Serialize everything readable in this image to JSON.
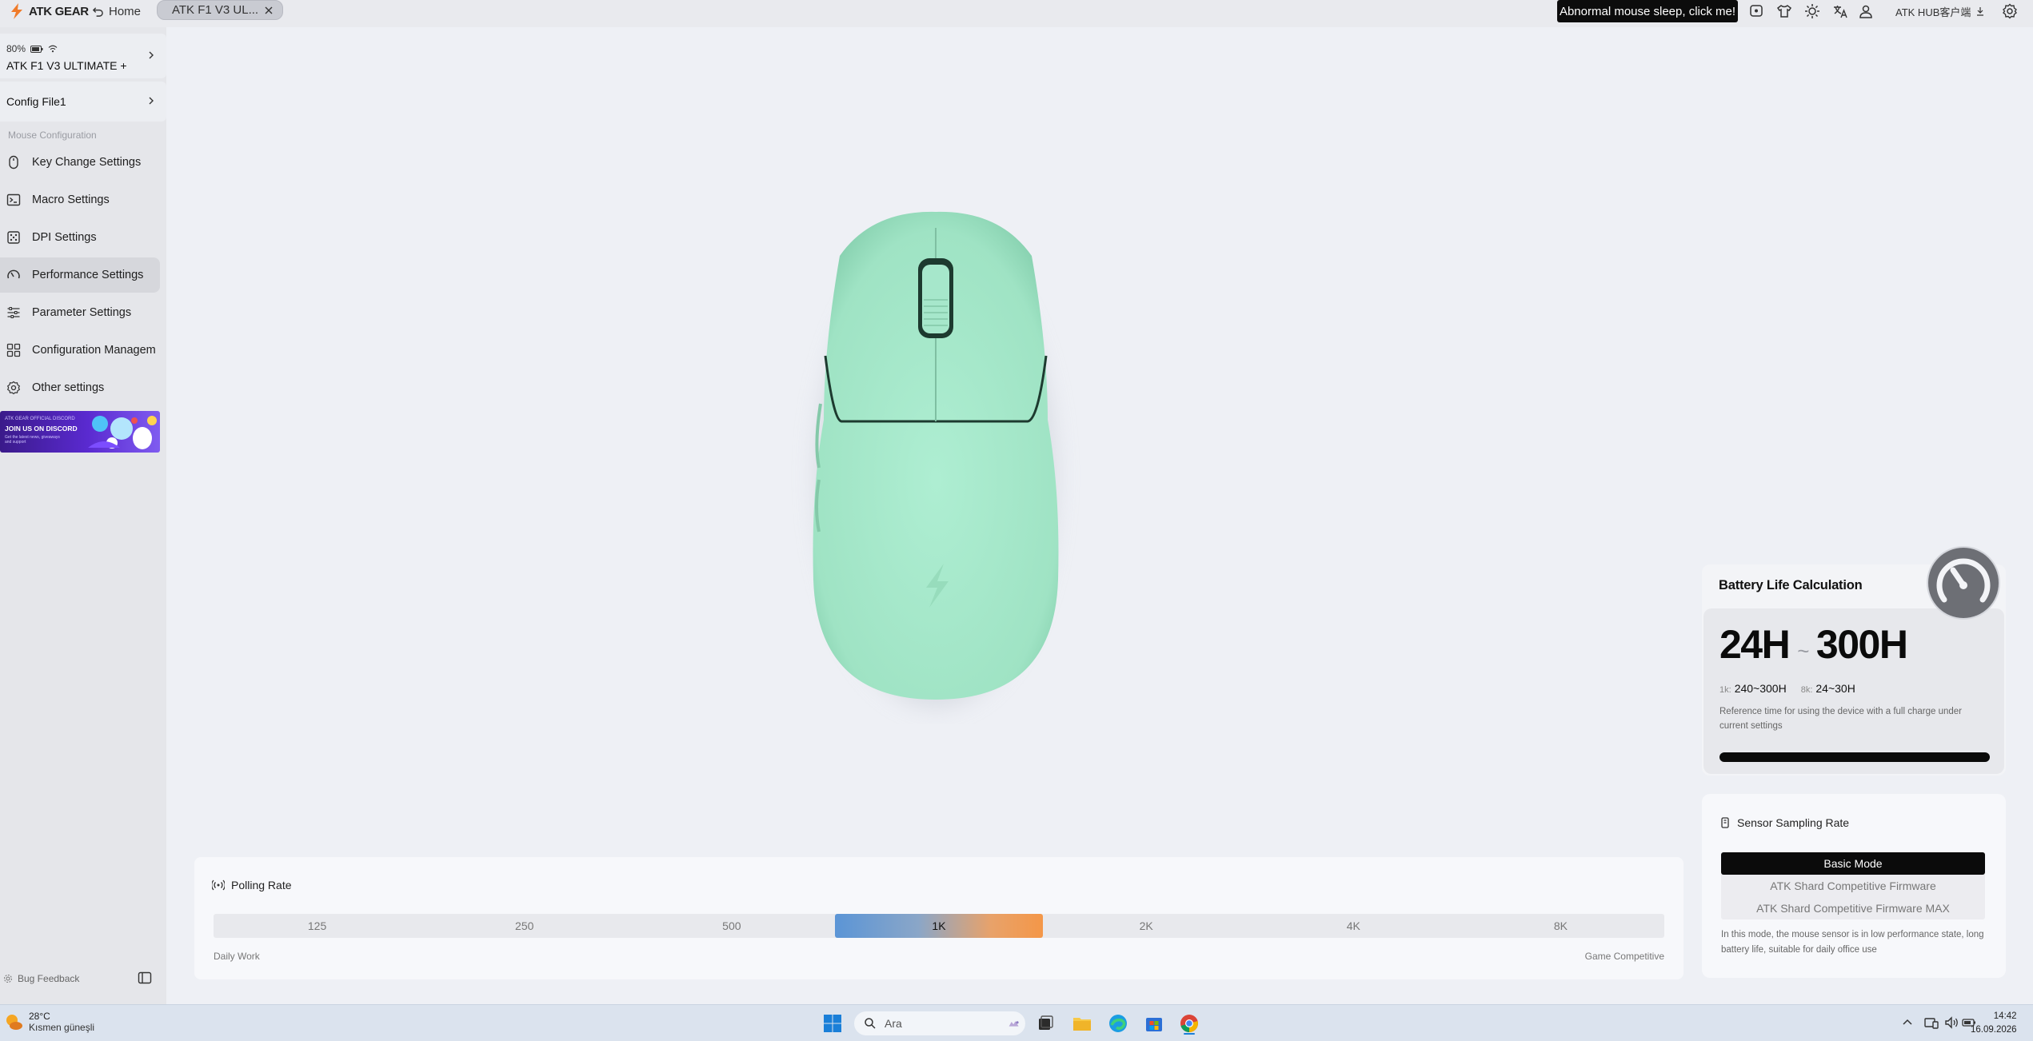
{
  "topbar": {
    "brand": "ATK GEAR",
    "home_label": "Home",
    "tab_label": "ATK F1 V3 UL...",
    "notice": "Abnormal mouse sleep, click me!",
    "hub_label": "ATK HUB客户端"
  },
  "device": {
    "battery": "80%",
    "name": "ATK F1 V3 ULTIMATE +",
    "config": "Config File1"
  },
  "sidebar": {
    "section_title": "Mouse Configuration",
    "items": [
      {
        "label": "Key Change Settings",
        "icon": "mouse-icon"
      },
      {
        "label": "Macro Settings",
        "icon": "terminal-icon"
      },
      {
        "label": "DPI Settings",
        "icon": "dice-icon"
      },
      {
        "label": "Performance Settings",
        "icon": "gauge-icon",
        "active": true
      },
      {
        "label": "Parameter Settings",
        "icon": "sliders-icon"
      },
      {
        "label": "Configuration Managem",
        "icon": "grid-icon"
      },
      {
        "label": "Other settings",
        "icon": "gear-icon"
      }
    ],
    "banner": {
      "line1": "ATK GEAR OFFICIAL DISCORD",
      "line2": "JOIN US ON DISCORD",
      "line3": "Get the latest news, giveaways and support"
    },
    "bug_feedback": "Bug Feedback"
  },
  "polling": {
    "title": "Polling Rate",
    "rates": [
      "125",
      "250",
      "500",
      "1K",
      "2K",
      "4K",
      "8K"
    ],
    "selected": "1K",
    "left_label": "Daily Work",
    "right_label": "Game Competitive"
  },
  "battery": {
    "title": "Battery Life Calculation",
    "min": "24H",
    "sep": "~",
    "max": "300H",
    "rate1_key": "1k:",
    "rate1_val": "240~300H",
    "rate2_key": "8k:",
    "rate2_val": "24~30H",
    "desc": "Reference time for using the device with a full charge under current settings"
  },
  "sensor": {
    "title": "Sensor Sampling Rate",
    "modes": [
      "Basic Mode",
      "ATK Shard Competitive Firmware",
      "ATK Shard Competitive Firmware MAX"
    ],
    "selected": "Basic Mode",
    "desc": "In this mode, the mouse sensor is in low performance state, long battery life, suitable for daily office use"
  },
  "taskbar": {
    "temp": "28°C",
    "weather": "Kısmen güneşli",
    "search_placeholder": "Ara",
    "time": "14:42",
    "date": "16.09.2026"
  },
  "colors": {
    "mouse": "#a3e6c8",
    "accent_black": "#0b0b0b",
    "polling_gradient_start": "#5b95d6",
    "polling_gradient_end": "#f49748"
  }
}
